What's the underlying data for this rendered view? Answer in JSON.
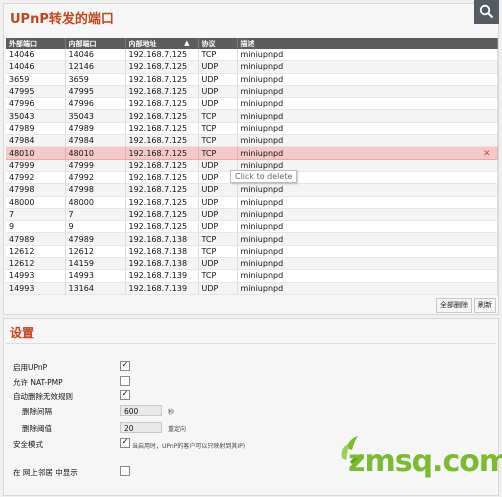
{
  "title": "UPnP转发的端口",
  "table": {
    "columns": [
      "外部端口",
      "内部端口",
      "内部地址",
      "协议",
      "描述"
    ],
    "rows": [
      [
        "14046",
        "14046",
        "192.168.7.125",
        "TCP",
        "miniupnpd"
      ],
      [
        "14046",
        "12146",
        "192.168.7.125",
        "UDP",
        "miniupnpd"
      ],
      [
        "3659",
        "3659",
        "192.168.7.125",
        "UDP",
        "miniupnpd"
      ],
      [
        "47995",
        "47995",
        "192.168.7.125",
        "UDP",
        "miniupnpd"
      ],
      [
        "47996",
        "47996",
        "192.168.7.125",
        "UDP",
        "miniupnpd"
      ],
      [
        "35043",
        "35043",
        "192.168.7.125",
        "TCP",
        "miniupnpd"
      ],
      [
        "47989",
        "47989",
        "192.168.7.125",
        "TCP",
        "miniupnpd"
      ],
      [
        "47984",
        "47984",
        "192.168.7.125",
        "TCP",
        "miniupnpd"
      ],
      [
        "48010",
        "48010",
        "192.168.7.125",
        "TCP",
        "miniupnpd"
      ],
      [
        "47999",
        "47999",
        "192.168.7.125",
        "UDP",
        "miniupnpd"
      ],
      [
        "47992",
        "47992",
        "192.168.7.125",
        "UDP",
        "miniupnpd"
      ],
      [
        "47998",
        "47998",
        "192.168.7.125",
        "UDP",
        "miniupnpd"
      ],
      [
        "48000",
        "48000",
        "192.168.7.125",
        "UDP",
        "miniupnpd"
      ],
      [
        "7",
        "7",
        "192.168.7.125",
        "UDP",
        "miniupnpd"
      ],
      [
        "9",
        "9",
        "192.168.7.125",
        "UDP",
        "miniupnpd"
      ],
      [
        "47989",
        "47989",
        "192.168.7.138",
        "TCP",
        "miniupnpd"
      ],
      [
        "12612",
        "12612",
        "192.168.7.138",
        "TCP",
        "miniupnpd"
      ],
      [
        "12612",
        "14159",
        "192.168.7.138",
        "UDP",
        "miniupnpd"
      ],
      [
        "14993",
        "14993",
        "192.168.7.139",
        "TCP",
        "miniupnpd"
      ],
      [
        "14993",
        "13164",
        "192.168.7.139",
        "UDP",
        "miniupnpd"
      ]
    ],
    "highlighted_row": 8,
    "tooltip": "Click to delete",
    "delete_glyph": "✕"
  },
  "buttons": {
    "delete_all": "全部删除",
    "refresh": "刷新"
  },
  "settings": {
    "title": "设置",
    "enable_upnp": {
      "label": "启用UPnP",
      "checked": true
    },
    "allow_natpmp": {
      "label": "允许 NAT-PMP",
      "checked": false
    },
    "auto_delete": {
      "label": "自动删除无效规则",
      "checked": true
    },
    "interval": {
      "label": "删除间隔",
      "value": "600",
      "unit": "秒"
    },
    "threshold": {
      "label": "删除阈值",
      "value": "20",
      "unit": "重定向"
    },
    "secure_mode": {
      "label": "安全模式",
      "checked": true,
      "hint": "当启用时，UPnP的客户可以只映射到其IP)"
    },
    "show_in_network": {
      "label": "在 网上邻居 中显示",
      "checked": false
    }
  },
  "watermark": "zmsq.com",
  "colors": {
    "accent": "#c2451f",
    "header_bg": "#5c5c5c",
    "highlight": "#f4c9c9",
    "watermark": "#7cba2f"
  },
  "icons": {
    "search": "magnifier-icon",
    "sort": "sort-arrow-icon",
    "delete": "close-icon"
  }
}
